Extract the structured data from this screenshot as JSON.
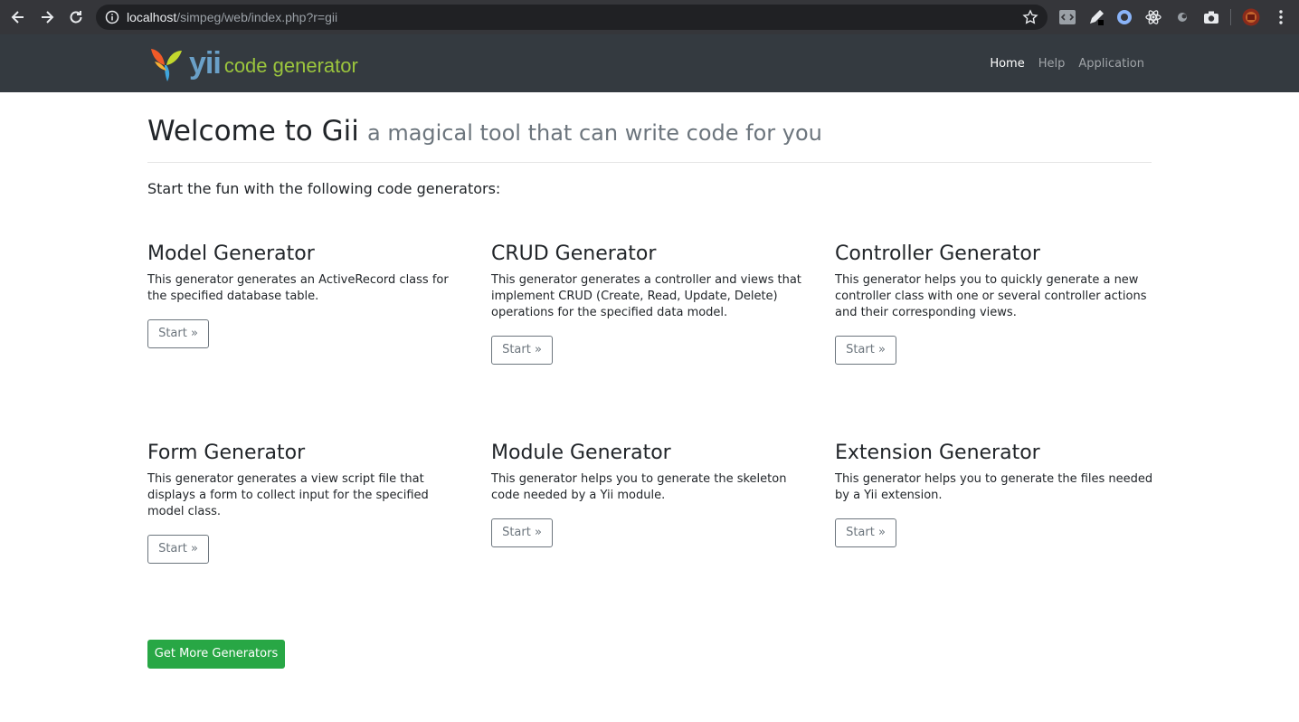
{
  "browser": {
    "url_host": "localhost",
    "url_path": "/simpeg/web/index.php?r=gii",
    "back_icon": "arrow-left-icon",
    "forward_icon": "arrow-right-icon",
    "reload_icon": "reload-icon"
  },
  "navbar": {
    "brand_yii": "yii",
    "brand_text": "code generator",
    "links": [
      {
        "label": "Home",
        "active": true
      },
      {
        "label": "Help",
        "active": false
      },
      {
        "label": "Application",
        "active": false
      }
    ]
  },
  "header": {
    "title": "Welcome to Gii",
    "subtitle": "a magical tool that can write code for you"
  },
  "lead": "Start the fun with the following code generators:",
  "generators": [
    {
      "title": "Model Generator",
      "desc": "This generator generates an ActiveRecord class for the specified database table.",
      "button": "Start »"
    },
    {
      "title": "CRUD Generator",
      "desc": "This generator generates a controller and views that implement CRUD (Create, Read, Update, Delete) operations for the specified data model.",
      "button": "Start »"
    },
    {
      "title": "Controller Generator",
      "desc": "This generator helps you to quickly generate a new controller class with one or several controller actions and their corresponding views.",
      "button": "Start »"
    },
    {
      "title": "Form Generator",
      "desc": "This generator generates a view script file that displays a form to collect input for the specified model class.",
      "button": "Start »"
    },
    {
      "title": "Module Generator",
      "desc": "This generator helps you to generate the skeleton code needed by a Yii module.",
      "button": "Start »"
    },
    {
      "title": "Extension Generator",
      "desc": "This generator helps you to generate the files needed by a Yii extension.",
      "button": "Start »"
    }
  ],
  "more_button": "Get More Generators"
}
